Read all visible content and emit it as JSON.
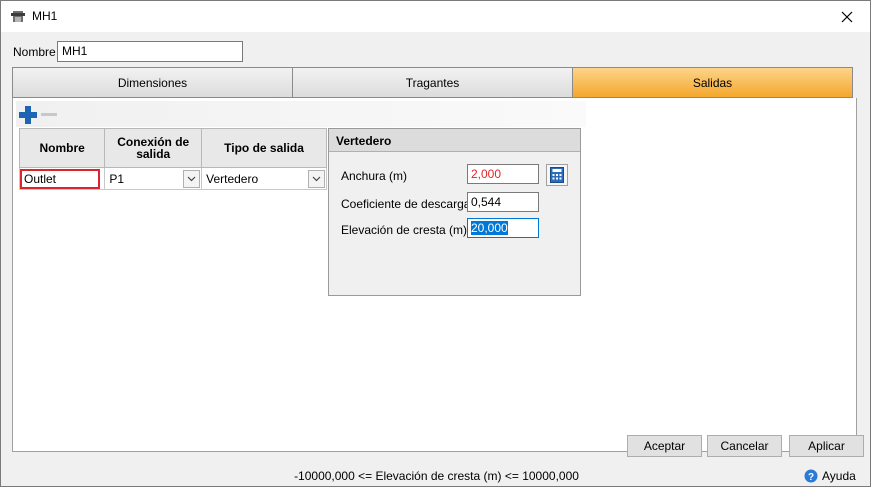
{
  "window": {
    "title": "MH1"
  },
  "form": {
    "name_label": "Nombre",
    "name_value": "MH1"
  },
  "tabs": [
    {
      "label": "Dimensiones",
      "active": false
    },
    {
      "label": "Tragantes",
      "active": false
    },
    {
      "label": "Salidas",
      "active": true
    }
  ],
  "toolbar": {
    "add_icon": "plus-icon",
    "remove_icon": "minus-icon"
  },
  "grid": {
    "headers": [
      "Nombre",
      "Conexión de salida",
      "Tipo de salida"
    ],
    "rows": [
      {
        "name": "Outlet",
        "connection": "P1",
        "type": "Vertedero"
      }
    ]
  },
  "vertedero": {
    "title": "Vertedero",
    "fields": [
      {
        "label": "Anchura (m)",
        "value": "2,000"
      },
      {
        "label": "Coeficiente de descarga",
        "value": "0,544"
      },
      {
        "label": "Elevación de cresta (m)",
        "value": "20,000"
      }
    ]
  },
  "buttons": {
    "accept": "Aceptar",
    "cancel": "Cancelar",
    "apply": "Aplicar"
  },
  "status": {
    "text": "-10000,000 <= Elevación de cresta (m) <= 10000,000"
  },
  "help": {
    "label": "Ayuda"
  },
  "colors": {
    "active_tab": "#f4a72c",
    "invalid": "#e3242b",
    "selection": "#0078d7",
    "add_icon": "#1e64b4"
  }
}
